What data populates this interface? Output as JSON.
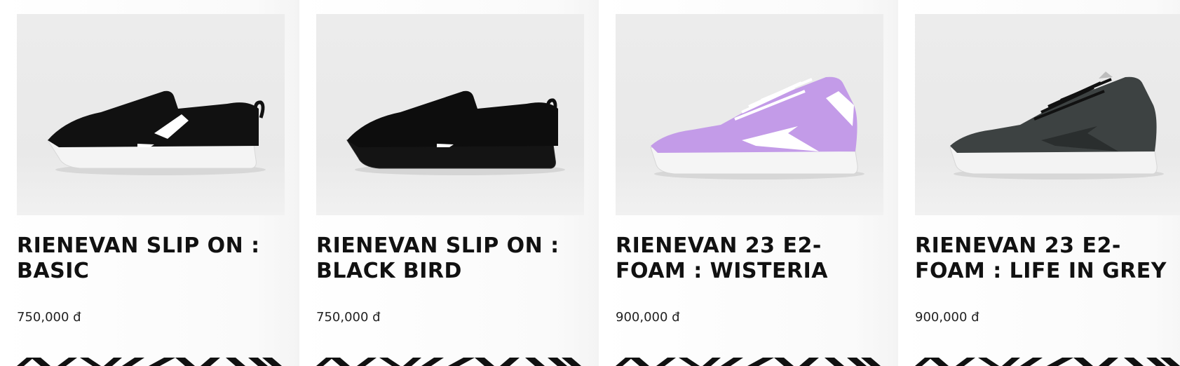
{
  "products": [
    {
      "title": "RIENEVAN SLIP ON : BASIC",
      "price": "750,000 đ",
      "shoe_color": "#111111",
      "sole_color": "#f2f2f2"
    },
    {
      "title": "RIENEVAN SLIP ON : BLACK BIRD",
      "price": "750,000 đ",
      "shoe_color": "#0d0d0d",
      "sole_color": "#141414"
    },
    {
      "title": "RIENEVAN 23 E2-FOAM : WISTERIA",
      "price": "900,000 đ",
      "shoe_color": "#c39be8",
      "sole_color": "#f5f5f5"
    },
    {
      "title": "RIENEVAN 23 E2-FOAM : LIFE IN GREY",
      "price": "900,000 đ",
      "shoe_color": "#3d4242",
      "sole_color": "#f3f3f3"
    }
  ]
}
